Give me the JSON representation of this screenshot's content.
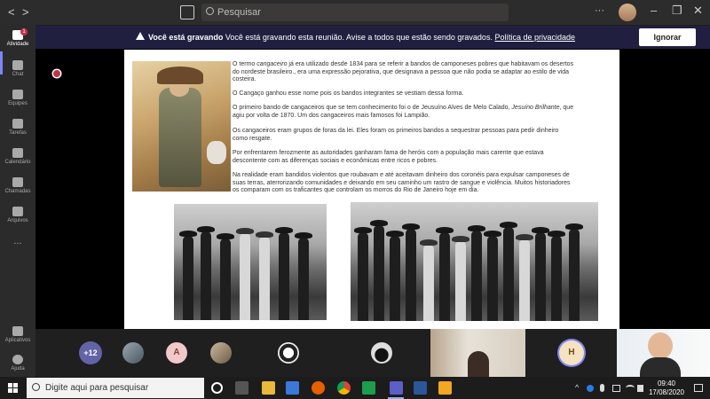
{
  "titlebar": {
    "back": "<",
    "forward": ">",
    "search_placeholder": "Pesquisar",
    "minimize": "–",
    "maximize": "❐",
    "close": "✕"
  },
  "banner": {
    "title": "Você está gravando",
    "message": "Você está gravando esta reunião. Avise a todos que estão sendo gravados.",
    "privacy_link": "Política de privacidade",
    "ignore_button": "Ignorar",
    "color": "#201f40"
  },
  "rail": {
    "activity_badge": "1",
    "items": [
      {
        "label": "Atividade",
        "icon": "bell-icon"
      },
      {
        "label": "Chat",
        "icon": "chat-icon"
      },
      {
        "label": "Equipes",
        "icon": "teams-icon"
      },
      {
        "label": "Tarefas",
        "icon": "tasks-icon"
      },
      {
        "label": "Calendário",
        "icon": "calendar-icon"
      },
      {
        "label": "Chamadas",
        "icon": "phone-icon"
      },
      {
        "label": "Arquivos",
        "icon": "files-icon"
      },
      {
        "label": "...",
        "icon": "more-icon"
      },
      {
        "label": "Aplicativos",
        "icon": "apps-icon"
      },
      {
        "label": "Ajuda",
        "icon": "help-icon"
      }
    ]
  },
  "document": {
    "p1_a": "O termo ",
    "p1_i": "cangaceiro",
    "p1_b": " já era utilizado desde 1834 para se referir a bandos de camponeses pobres que habitavam os desertos do nordeste brasileiro., era uma expressão pejorativa, que designava a pessoa que não podia se adaptar ao estilo de vida costeira.",
    "p2": "O Cangaço ganhou esse nome pois os bandos integrantes se vestiam dessa forma.",
    "p3_a": "O primeiro bando de cangaceiros que se tem conhecimento foi o de Jeusuíno Alves de Melo Calado, ",
    "p3_i": "Jesuíno Brilhante",
    "p3_b": ", que agiu por volta de 1870. Um dos cangaceiros mais famosos foi Lampião.",
    "p4": "Os cangaceiros eram grupos de foras da lei. Eles foram os primeiros bandos a sequestrar pessoas para pedir dinheiro como resgate.",
    "p5": "Por enfrentarem ferozmente as autoridades ganharam fama de heróis com a população mais carente que estava descontente com as diferenças sociais e econômicas entre ricos e pobres.",
    "p6": "Na realidade eram bandidos violentos que roubavam e até aceitavam dinheiro dos coronéis para expulsar camponeses de suas terras, aterrorizando comunidades e deixando em seu caminho um rastro de sangue e violência. Muitos historiadores os comparam com os traficantes que controlam os morros do Rio de Janeiro hoje em dia."
  },
  "participants": {
    "overflow": "+12",
    "a_initial": "A",
    "h_initial": "H",
    "overflow_color": "#6264a7",
    "a_color": "#f1c9c9"
  },
  "taskbar": {
    "search_placeholder": "Digite aqui para pesquisar",
    "time": "09:40",
    "date": "17/08/2020",
    "tray_up": "^"
  }
}
